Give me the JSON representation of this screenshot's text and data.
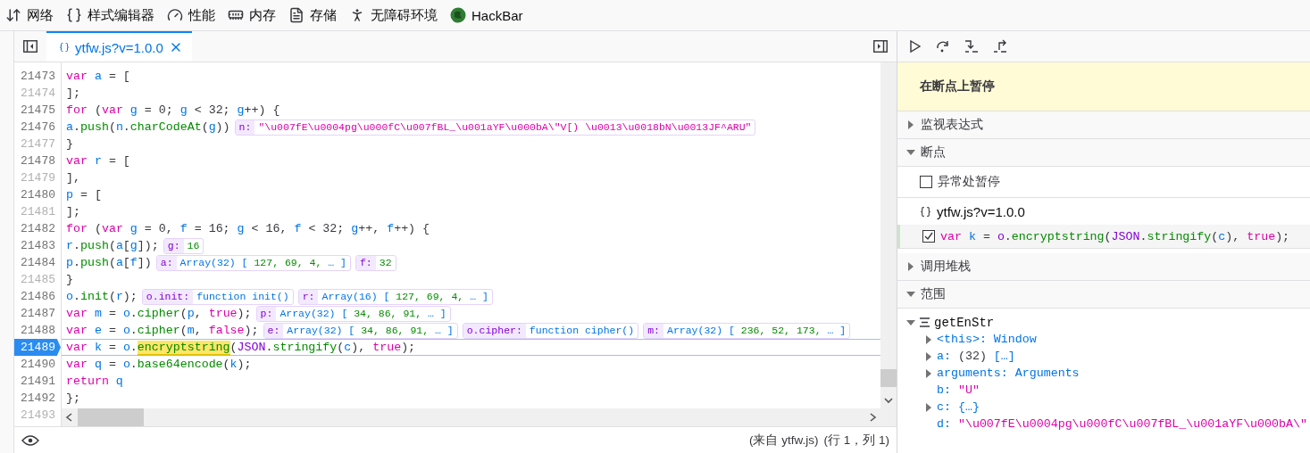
{
  "toolbar": {
    "tabs": [
      {
        "kind": "network",
        "label": "网络"
      },
      {
        "kind": "style",
        "label": "样式编辑器"
      },
      {
        "kind": "performance",
        "label": "性能"
      },
      {
        "kind": "memory",
        "label": "内存"
      },
      {
        "kind": "storage",
        "label": "存储"
      },
      {
        "kind": "accessibility",
        "label": "无障碍环境"
      },
      {
        "kind": "hackbar",
        "label": "HackBar"
      }
    ]
  },
  "editor": {
    "tabs": [
      {
        "label": "ytfw.js?v=1.0.0",
        "selected": true
      }
    ],
    "lines": [
      {
        "number": "21473",
        "breakable": true,
        "paused": false,
        "code": [
          {
            "kind": "kw",
            "text": "var"
          },
          {
            "kind": "id",
            "text": " a"
          },
          {
            "kind": "p",
            "text": " = ["
          }
        ]
      },
      {
        "number": "21474",
        "breakable": false,
        "paused": false,
        "code": [
          {
            "kind": "p",
            "text": "];"
          }
        ]
      },
      {
        "number": "21475",
        "breakable": true,
        "paused": false,
        "code": [
          {
            "kind": "kw",
            "text": "for"
          },
          {
            "kind": "p",
            "text": " ("
          },
          {
            "kind": "kw",
            "text": "var"
          },
          {
            "kind": "id",
            "text": " g"
          },
          {
            "kind": "p",
            "text": " = 0; "
          },
          {
            "kind": "id",
            "text": "g"
          },
          {
            "kind": "p",
            "text": " < 32; "
          },
          {
            "kind": "id",
            "text": "g"
          },
          {
            "kind": "p",
            "text": "++) {"
          }
        ]
      },
      {
        "number": "21476",
        "breakable": true,
        "paused": false,
        "code": [
          {
            "kind": "id",
            "text": "a"
          },
          {
            "kind": "p",
            "text": "."
          },
          {
            "kind": "fn",
            "text": "push"
          },
          {
            "kind": "p",
            "text": "("
          },
          {
            "kind": "id",
            "text": "n"
          },
          {
            "kind": "p",
            "text": "."
          },
          {
            "kind": "fn",
            "text": "charCodeAt"
          },
          {
            "kind": "p",
            "text": "("
          },
          {
            "kind": "id",
            "text": "g"
          },
          {
            "kind": "p",
            "text": "))"
          }
        ],
        "previews": [
          {
            "label": "n:",
            "value": [
              {
                "kind": "str",
                "text": "\"\\u007fE\\u0004pg\\u000fC\\u007fBL_\\u001aYF\\u000bA\\\"V[) \\u0013\\u0018bN\\u0013JF^ARU\""
              }
            ]
          }
        ]
      },
      {
        "number": "21477",
        "breakable": false,
        "paused": false,
        "code": [
          {
            "kind": "p",
            "text": "}"
          }
        ]
      },
      {
        "number": "21478",
        "breakable": true,
        "paused": false,
        "code": [
          {
            "kind": "kw",
            "text": "var"
          },
          {
            "kind": "id",
            "text": " r"
          },
          {
            "kind": "p",
            "text": " = ["
          }
        ]
      },
      {
        "number": "21479",
        "breakable": false,
        "paused": false,
        "code": [
          {
            "kind": "p",
            "text": "],"
          }
        ]
      },
      {
        "number": "21480",
        "breakable": true,
        "paused": false,
        "code": [
          {
            "kind": "id",
            "text": "p"
          },
          {
            "kind": "p",
            "text": " = ["
          }
        ]
      },
      {
        "number": "21481",
        "breakable": false,
        "paused": false,
        "code": [
          {
            "kind": "p",
            "text": "];"
          }
        ]
      },
      {
        "number": "21482",
        "breakable": true,
        "paused": false,
        "code": [
          {
            "kind": "kw",
            "text": "for"
          },
          {
            "kind": "p",
            "text": " ("
          },
          {
            "kind": "kw",
            "text": "var"
          },
          {
            "kind": "id",
            "text": " g"
          },
          {
            "kind": "p",
            "text": " = 0, "
          },
          {
            "kind": "id",
            "text": "f"
          },
          {
            "kind": "p",
            "text": " = 16; "
          },
          {
            "kind": "id",
            "text": "g"
          },
          {
            "kind": "p",
            "text": " < 16, "
          },
          {
            "kind": "id",
            "text": "f"
          },
          {
            "kind": "p",
            "text": " < 32; "
          },
          {
            "kind": "id",
            "text": "g"
          },
          {
            "kind": "p",
            "text": "++, "
          },
          {
            "kind": "id",
            "text": "f"
          },
          {
            "kind": "p",
            "text": "++) {"
          }
        ]
      },
      {
        "number": "21483",
        "breakable": true,
        "paused": false,
        "code": [
          {
            "kind": "id",
            "text": "r"
          },
          {
            "kind": "p",
            "text": "."
          },
          {
            "kind": "fn",
            "text": "push"
          },
          {
            "kind": "p",
            "text": "("
          },
          {
            "kind": "id",
            "text": "a"
          },
          {
            "kind": "p",
            "text": "["
          },
          {
            "kind": "id",
            "text": "g"
          },
          {
            "kind": "p",
            "text": "]);"
          }
        ],
        "previews": [
          {
            "label": "g:",
            "value": [
              {
                "kind": "num",
                "text": "16"
              }
            ]
          }
        ]
      },
      {
        "number": "21484",
        "breakable": true,
        "paused": false,
        "code": [
          {
            "kind": "id",
            "text": "p"
          },
          {
            "kind": "p",
            "text": "."
          },
          {
            "kind": "fn",
            "text": "push"
          },
          {
            "kind": "p",
            "text": "("
          },
          {
            "kind": "id",
            "text": "a"
          },
          {
            "kind": "p",
            "text": "["
          },
          {
            "kind": "id",
            "text": "f"
          },
          {
            "kind": "p",
            "text": "])"
          }
        ],
        "previews": [
          {
            "label": "a:",
            "value": [
              {
                "kind": "type",
                "text": "Array(32) [ "
              },
              {
                "kind": "num",
                "text": "127, 69, 4,"
              },
              {
                "kind": "type",
                "text": " … ]"
              }
            ]
          },
          {
            "label": "f:",
            "value": [
              {
                "kind": "num",
                "text": "32"
              }
            ]
          }
        ]
      },
      {
        "number": "21485",
        "breakable": false,
        "paused": false,
        "code": [
          {
            "kind": "p",
            "text": "}"
          }
        ]
      },
      {
        "number": "21486",
        "breakable": true,
        "paused": false,
        "code": [
          {
            "kind": "id",
            "text": "o"
          },
          {
            "kind": "p",
            "text": "."
          },
          {
            "kind": "fn",
            "text": "init"
          },
          {
            "kind": "p",
            "text": "("
          },
          {
            "kind": "id",
            "text": "r"
          },
          {
            "kind": "p",
            "text": ");"
          }
        ],
        "previews": [
          {
            "label": "o.init:",
            "value": [
              {
                "kind": "type",
                "text": "function init()"
              }
            ]
          },
          {
            "label": "r:",
            "value": [
              {
                "kind": "type",
                "text": "Array(16) [ "
              },
              {
                "kind": "num",
                "text": "127, 69, 4,"
              },
              {
                "kind": "type",
                "text": " … ]"
              }
            ]
          }
        ]
      },
      {
        "number": "21487",
        "breakable": true,
        "paused": false,
        "code": [
          {
            "kind": "kw",
            "text": "var"
          },
          {
            "kind": "id",
            "text": " m"
          },
          {
            "kind": "p",
            "text": " = "
          },
          {
            "kind": "id",
            "text": "o"
          },
          {
            "kind": "p",
            "text": "."
          },
          {
            "kind": "fn",
            "text": "cipher"
          },
          {
            "kind": "p",
            "text": "("
          },
          {
            "kind": "id",
            "text": "p"
          },
          {
            "kind": "p",
            "text": ", "
          },
          {
            "kind": "kw",
            "text": "true"
          },
          {
            "kind": "p",
            "text": ");"
          }
        ],
        "previews": [
          {
            "label": "p:",
            "value": [
              {
                "kind": "type",
                "text": "Array(32) [ "
              },
              {
                "kind": "num",
                "text": "34, 86, 91,"
              },
              {
                "kind": "type",
                "text": " … ]"
              }
            ]
          }
        ]
      },
      {
        "number": "21488",
        "breakable": true,
        "paused": false,
        "code": [
          {
            "kind": "kw",
            "text": "var"
          },
          {
            "kind": "id",
            "text": " e"
          },
          {
            "kind": "p",
            "text": " = "
          },
          {
            "kind": "id",
            "text": "o"
          },
          {
            "kind": "p",
            "text": "."
          },
          {
            "kind": "fn",
            "text": "cipher"
          },
          {
            "kind": "p",
            "text": "("
          },
          {
            "kind": "id",
            "text": "m"
          },
          {
            "kind": "p",
            "text": ", "
          },
          {
            "kind": "kw",
            "text": "false"
          },
          {
            "kind": "p",
            "text": ");"
          }
        ],
        "previews": [
          {
            "label": "e:",
            "value": [
              {
                "kind": "type",
                "text": "Array(32) [ "
              },
              {
                "kind": "num",
                "text": "34, 86, 91,"
              },
              {
                "kind": "type",
                "text": " … ]"
              }
            ]
          },
          {
            "label": "o.cipher:",
            "value": [
              {
                "kind": "type",
                "text": "function cipher()"
              }
            ]
          },
          {
            "label": "m:",
            "value": [
              {
                "kind": "type",
                "text": "Array(32) [ "
              },
              {
                "kind": "num",
                "text": "236, 52, 173,"
              },
              {
                "kind": "type",
                "text": " … ]"
              }
            ]
          }
        ]
      },
      {
        "number": "21489",
        "breakable": true,
        "paused": true,
        "code": [
          {
            "kind": "kw",
            "text": "var"
          },
          {
            "kind": "id",
            "text": " k"
          },
          {
            "kind": "p",
            "text": " = "
          },
          {
            "kind": "id",
            "text": "o"
          },
          {
            "kind": "p",
            "text": "."
          },
          {
            "kind": "match",
            "text": "encryptstring"
          },
          {
            "kind": "p",
            "text": "("
          },
          {
            "kind": "obj",
            "text": "JSON"
          },
          {
            "kind": "p",
            "text": "."
          },
          {
            "kind": "fn",
            "text": "stringify"
          },
          {
            "kind": "p",
            "text": "("
          },
          {
            "kind": "id",
            "text": "c"
          },
          {
            "kind": "p",
            "text": "), "
          },
          {
            "kind": "kw",
            "text": "true"
          },
          {
            "kind": "p",
            "text": ");"
          }
        ]
      },
      {
        "number": "21490",
        "breakable": true,
        "paused": false,
        "code": [
          {
            "kind": "kw",
            "text": "var"
          },
          {
            "kind": "id",
            "text": " q"
          },
          {
            "kind": "p",
            "text": " = "
          },
          {
            "kind": "id",
            "text": "o"
          },
          {
            "kind": "p",
            "text": "."
          },
          {
            "kind": "fn",
            "text": "base64encode"
          },
          {
            "kind": "p",
            "text": "("
          },
          {
            "kind": "id",
            "text": "k"
          },
          {
            "kind": "p",
            "text": ");"
          }
        ]
      },
      {
        "number": "21491",
        "breakable": true,
        "paused": false,
        "code": [
          {
            "kind": "kw",
            "text": "return"
          },
          {
            "kind": "id",
            "text": " q"
          }
        ]
      },
      {
        "number": "21492",
        "breakable": true,
        "paused": false,
        "code": [
          {
            "kind": "p",
            "text": "};"
          }
        ]
      },
      {
        "number": "21493",
        "breakable": false,
        "paused": false
      }
    ],
    "footer": {
      "source": "(来自 ytfw.js)",
      "position": "(行 1，列 1)"
    }
  },
  "sidebar": {
    "pause_banner": "在断点上暂停",
    "sections": [
      {
        "kind": "watch",
        "title": "监视表达式",
        "expanded": false
      },
      {
        "kind": "breakpoints",
        "title": "断点",
        "expanded": true,
        "pause_on_exceptions": {
          "label": "异常处暂停",
          "checked": false
        },
        "files": [
          {
            "name": "ytfw.js?v=1.0.0",
            "breakpoints": [
              {
                "checked": true,
                "code": [
                  {
                    "kind": "kw",
                    "text": "var"
                  },
                  {
                    "kind": "id",
                    "text": " k"
                  },
                  {
                    "kind": "p",
                    "text": " = "
                  },
                  {
                    "kind": "obj",
                    "text": "o"
                  },
                  {
                    "kind": "p",
                    "text": "."
                  },
                  {
                    "kind": "fn",
                    "text": "encryptstring"
                  },
                  {
                    "kind": "p",
                    "text": "("
                  },
                  {
                    "kind": "obj",
                    "text": "JSON"
                  },
                  {
                    "kind": "p",
                    "text": "."
                  },
                  {
                    "kind": "fn",
                    "text": "stringify"
                  },
                  {
                    "kind": "p",
                    "text": "("
                  },
                  {
                    "kind": "id",
                    "text": "c"
                  },
                  {
                    "kind": "p",
                    "text": "), "
                  },
                  {
                    "kind": "kw",
                    "text": "true"
                  },
                  {
                    "kind": "p",
                    "text": ");"
                  }
                ]
              }
            ]
          }
        ]
      },
      {
        "kind": "callstack",
        "title": "调用堆栈",
        "expanded": false
      },
      {
        "kind": "scopes",
        "title": "范围",
        "expanded": true,
        "scopes": [
          {
            "name": "getEnStr",
            "expanded": true,
            "children": [
              {
                "name": "<this>:",
                "expandable": true,
                "value": [
                  {
                    "kind": "type",
                    "text": "Window"
                  }
                ]
              },
              {
                "name": "a:",
                "expandable": true,
                "value": [
                  {
                    "kind": "p",
                    "text": "(32)"
                  },
                  {
                    "kind": "type",
                    "text": " […]"
                  }
                ]
              },
              {
                "name": "arguments:",
                "expandable": true,
                "value": [
                  {
                    "kind": "type",
                    "text": "Arguments"
                  }
                ]
              },
              {
                "name": "b:",
                "expandable": false,
                "value": [
                  {
                    "kind": "str",
                    "text": "\"U\""
                  }
                ]
              },
              {
                "name": "c:",
                "expandable": true,
                "value": [
                  {
                    "kind": "type",
                    "text": "{…}"
                  }
                ]
              },
              {
                "name": "d:",
                "expandable": false,
                "value": [
                  {
                    "kind": "str",
                    "text": "\"\\u007fE\\u0004pg\\u000fC\\u007fBL_\\u001aYF\\u000bA\\\""
                  }
                ]
              }
            ]
          }
        ]
      }
    ]
  }
}
